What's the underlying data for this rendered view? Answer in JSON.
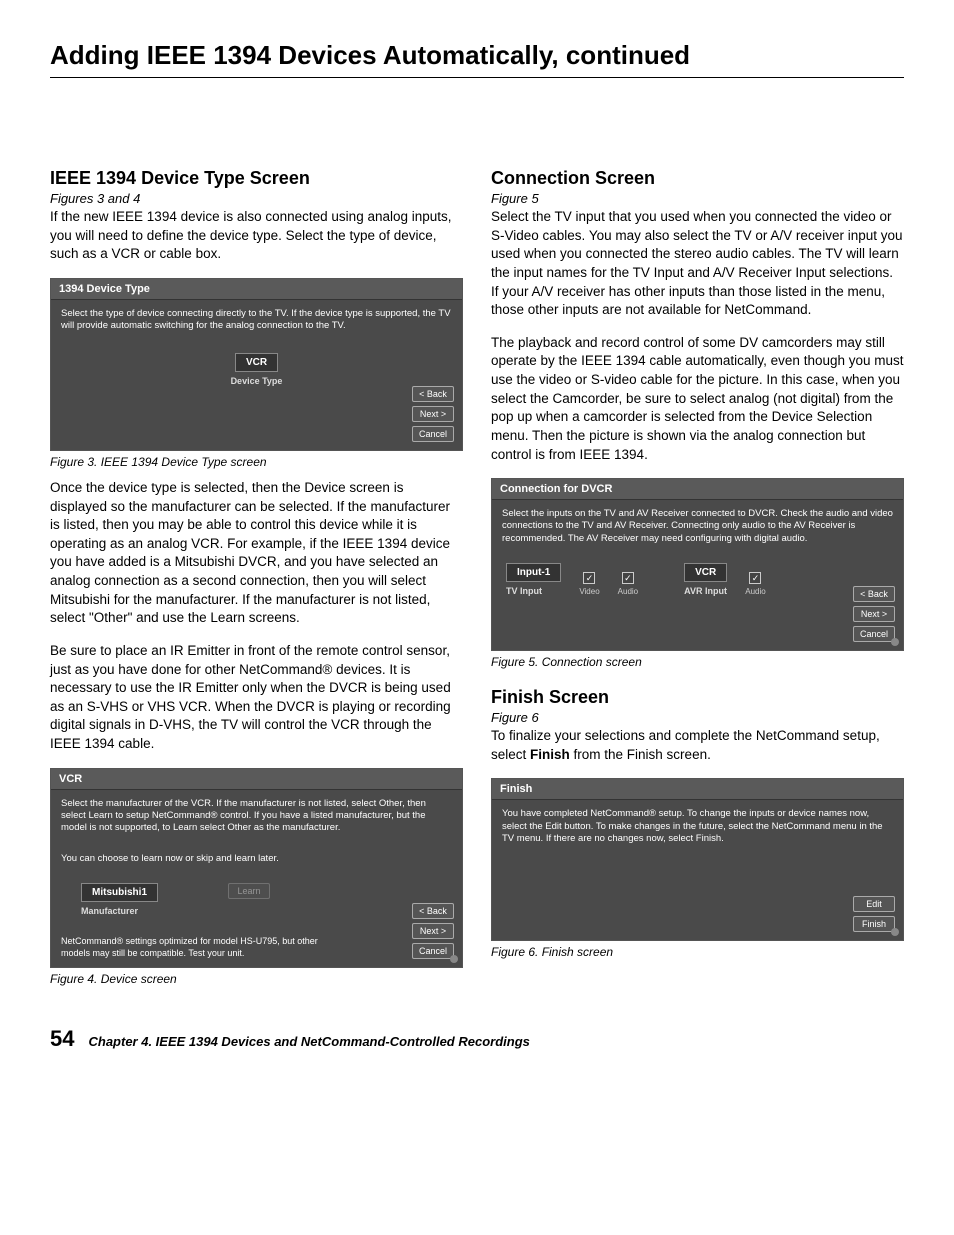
{
  "page_title": "Adding IEEE 1394 Devices Automatically, continued",
  "left": {
    "h1": "IEEE 1394 Device Type Screen",
    "sub1": "Figures 3 and 4",
    "p1": "If the new IEEE 1394 device is also connected using analog inputs, you will need to define the device type. Select the type of device, such as a VCR or cable box.",
    "fig3": {
      "title": "1394 Device Type",
      "prompt_a": "Select the type of device connecting directly to the TV.  If the device type is supported, the TV will provide automatic switching for the analog connection to the TV.",
      "sel_value": "VCR",
      "sel_label": "Device Type",
      "back": "< Back",
      "next": "Next >",
      "cancel": "Cancel"
    },
    "cap3": "Figure 3. IEEE 1394 Device Type screen",
    "p2": "Once the device type is selected, then the Device screen is displayed so the manufacturer can be selected. If the manufacturer is listed, then you may be able to control this device while it is operating as an analog VCR.  For example, if the IEEE 1394 device you have added is a Mitsubishi DVCR, and you have selected an analog connection as a second connection, then you will select Mitsubishi for the manufacturer.  If the manufacturer is not listed, select \"Other\" and use the Learn screens.",
    "p3": "Be sure to place an IR Emitter in front of the remote control sensor, just as you have done for other NetCommand® devices.  It is necessary to use the IR Emitter only when the DVCR is being used as an S-VHS or VHS VCR.  When the DVCR is playing or recording digital signals in D-VHS, the TV will control the VCR through the IEEE 1394 cable.",
    "fig4": {
      "title": "VCR",
      "prompt_a": "Select the manufacturer of the VCR.   If the manufacturer is not listed, select Other, then select Learn to setup NetCommand® control. If you have a listed manufacturer, but the model is not supported, to Learn select Other as the  manufacturer.",
      "prompt_b": "You can choose to learn now or skip and learn later.",
      "sel_value": "Mitsubishi1",
      "sel_label": "Manufacturer",
      "learn": "Learn",
      "back": "< Back",
      "next": "Next >",
      "cancel": "Cancel",
      "note": "NetCommand® settings optimized for model HS-U795, but other models may still be compatible. Test your unit."
    },
    "cap4": "Figure 4.  Device  screen"
  },
  "right": {
    "h1": "Connection Screen",
    "sub1": "Figure 5",
    "p1": "Select the TV input that you used when you connected the video or S-Video cables.  You may also select the TV or A/V receiver input you used when you connected the stereo audio cables.  The TV will learn the input names for the TV Input and A/V Receiver Input selections.  If your A/V receiver has other inputs than those listed in the menu, those other inputs are not available for NetCommand.",
    "p2": "The playback and record control of some DV camcorders may still operate by the IEEE 1394 cable automatically, even though you must use the video or S-video cable for the picture.  In this case, when you select the Camcorder, be sure to select analog (not digital) from the pop up when a camcorder is selected from the Device Selection menu.  Then the picture is shown via the analog connection but control is from IEEE 1394.",
    "fig5": {
      "title": "Connection for DVCR",
      "prompt": "Select the inputs on the TV and AV Receiver connected to DVCR.  Check the audio and video connections to the TV and AV Receiver.  Connecting only audio to the AV Receiver is recommended.   The AV Receiver may need configuring with digital audio.",
      "tv_value": "Input-1",
      "tv_label": "TV Input",
      "video": "Video",
      "audio": "Audio",
      "avr_value": "VCR",
      "avr_label": "AVR Input",
      "back": "< Back",
      "next": "Next >",
      "cancel": "Cancel"
    },
    "cap5": "Figure 5. Connection screen",
    "h2": "Finish Screen",
    "sub2": "Figure 6",
    "p3a": "To finalize your selections and complete the NetCommand setup, select ",
    "p3b": "Finish",
    "p3c": " from the Finish screen.",
    "fig6": {
      "title": "Finish",
      "prompt": "You have completed NetCommand® setup.  To change the inputs or device names now, select the Edit button.  To make changes in the future, select the NetCommand menu in the TV menu.  If there are no changes now, select Finish.",
      "edit": "Edit",
      "finish": "Finish"
    },
    "cap6": "Figure 6. Finish screen"
  },
  "footer": {
    "page": "54",
    "chapter": "Chapter 4. IEEE 1394 Devices and NetCommand-Controlled Recordings"
  }
}
